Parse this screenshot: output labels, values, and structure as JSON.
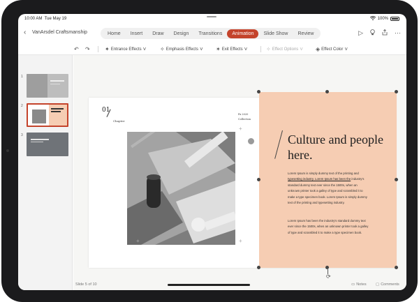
{
  "status_bar": {
    "time": "10:00 AM",
    "date": "Tue May 19",
    "wifi_icon": "wifi-icon",
    "battery": "100%"
  },
  "header": {
    "document_title": "VanArsdel Craftsmanship",
    "tabs": [
      {
        "label": "Home",
        "active": false
      },
      {
        "label": "Insert",
        "active": false
      },
      {
        "label": "Draw",
        "active": false
      },
      {
        "label": "Design",
        "active": false
      },
      {
        "label": "Transitions",
        "active": false
      },
      {
        "label": "Animation",
        "active": true
      },
      {
        "label": "Slide Show",
        "active": false
      },
      {
        "label": "Review",
        "active": false
      }
    ],
    "icons": [
      "play-icon",
      "lightbulb-icon",
      "share-icon",
      "more-icon"
    ],
    "accent_color": "#c4432b"
  },
  "ribbon": {
    "entrance_effects": "Entrance Effects",
    "emphasis_effects": "Emphasis Effects",
    "exit_effects": "Exit Effects",
    "effect_options": "Effect Options",
    "effect_color": "Effect Color"
  },
  "slides_panel": {
    "items": [
      {
        "number": "1",
        "selected": false
      },
      {
        "number": "2",
        "selected": true
      },
      {
        "number": "3",
        "selected": false
      }
    ]
  },
  "slide": {
    "chapter_number": "01",
    "chapter_label": "Chapter",
    "collection_year": "Fa 2020",
    "collection_label": "Collection",
    "heading": "Culture and people here.",
    "body1_plain": "Lorem Ipsum is simply dummy text of the printing and ",
    "body1_highlight": "typesetting industry. Lorem Ipsum has been the",
    "body1_rest": " industry's standard dummy text ever since the 1500s, when an unknown printer took a galley of type and scrambled it to make a type specimen book. Lorem Ipsum is simply dummy text of the printing and typesetting industry.",
    "body2": "Lorem Ipsum has been the industry's standard dummy text ever since the 1500s, when an unknown printer took a galley of type and scrambled it to make a type specimen book.",
    "selection_fill": "#f6cdb3"
  },
  "bottom_bar": {
    "slide_count": "Slide 5 of 10",
    "notes_label": "Notes",
    "comments_label": "Comments"
  }
}
